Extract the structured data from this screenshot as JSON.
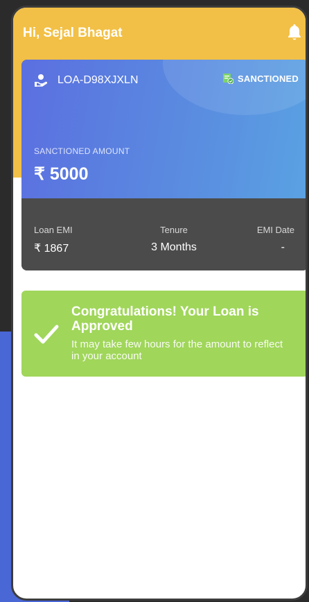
{
  "header": {
    "greeting": "Hi, Sejal Bhagat",
    "notification_icon": "bell-icon"
  },
  "loan_card": {
    "loan_id": "LOA-D98XJXLN",
    "loan_icon": "hand-money-icon",
    "status": "SANCTIONED",
    "status_icon": "document-check-icon",
    "amount_label": "SANCTIONED AMOUNT",
    "amount_value": "₹ 5000",
    "stats": {
      "emi_label": "Loan EMI",
      "emi_value": "₹ 1867",
      "tenure_label": "Tenure",
      "tenure_value": "3 Months",
      "date_label": "EMI Date",
      "date_value": "-"
    }
  },
  "approval": {
    "icon": "checkmark-icon",
    "title": "Congratulations! Your Loan is Approved",
    "message": "It may take few hours for the amount to reflect in your account"
  },
  "colors": {
    "header": "#f2c046",
    "card_gradient_start": "#5b6fe0",
    "card_gradient_end": "#5aa2e2",
    "card_footer": "#4b4b4b",
    "approval": "#a0d65a"
  }
}
